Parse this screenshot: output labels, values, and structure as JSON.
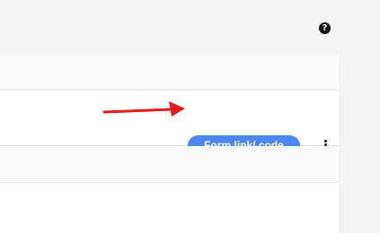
{
  "header": {
    "help_icon": "question-circle-icon",
    "help_glyph": "?"
  },
  "form_row": {
    "button_label": "Form link/ code",
    "button_color": "#4e86f0",
    "more_icon": "kebab-vertical-icon"
  },
  "annotation": {
    "arrow_color": "#e31b1b"
  }
}
